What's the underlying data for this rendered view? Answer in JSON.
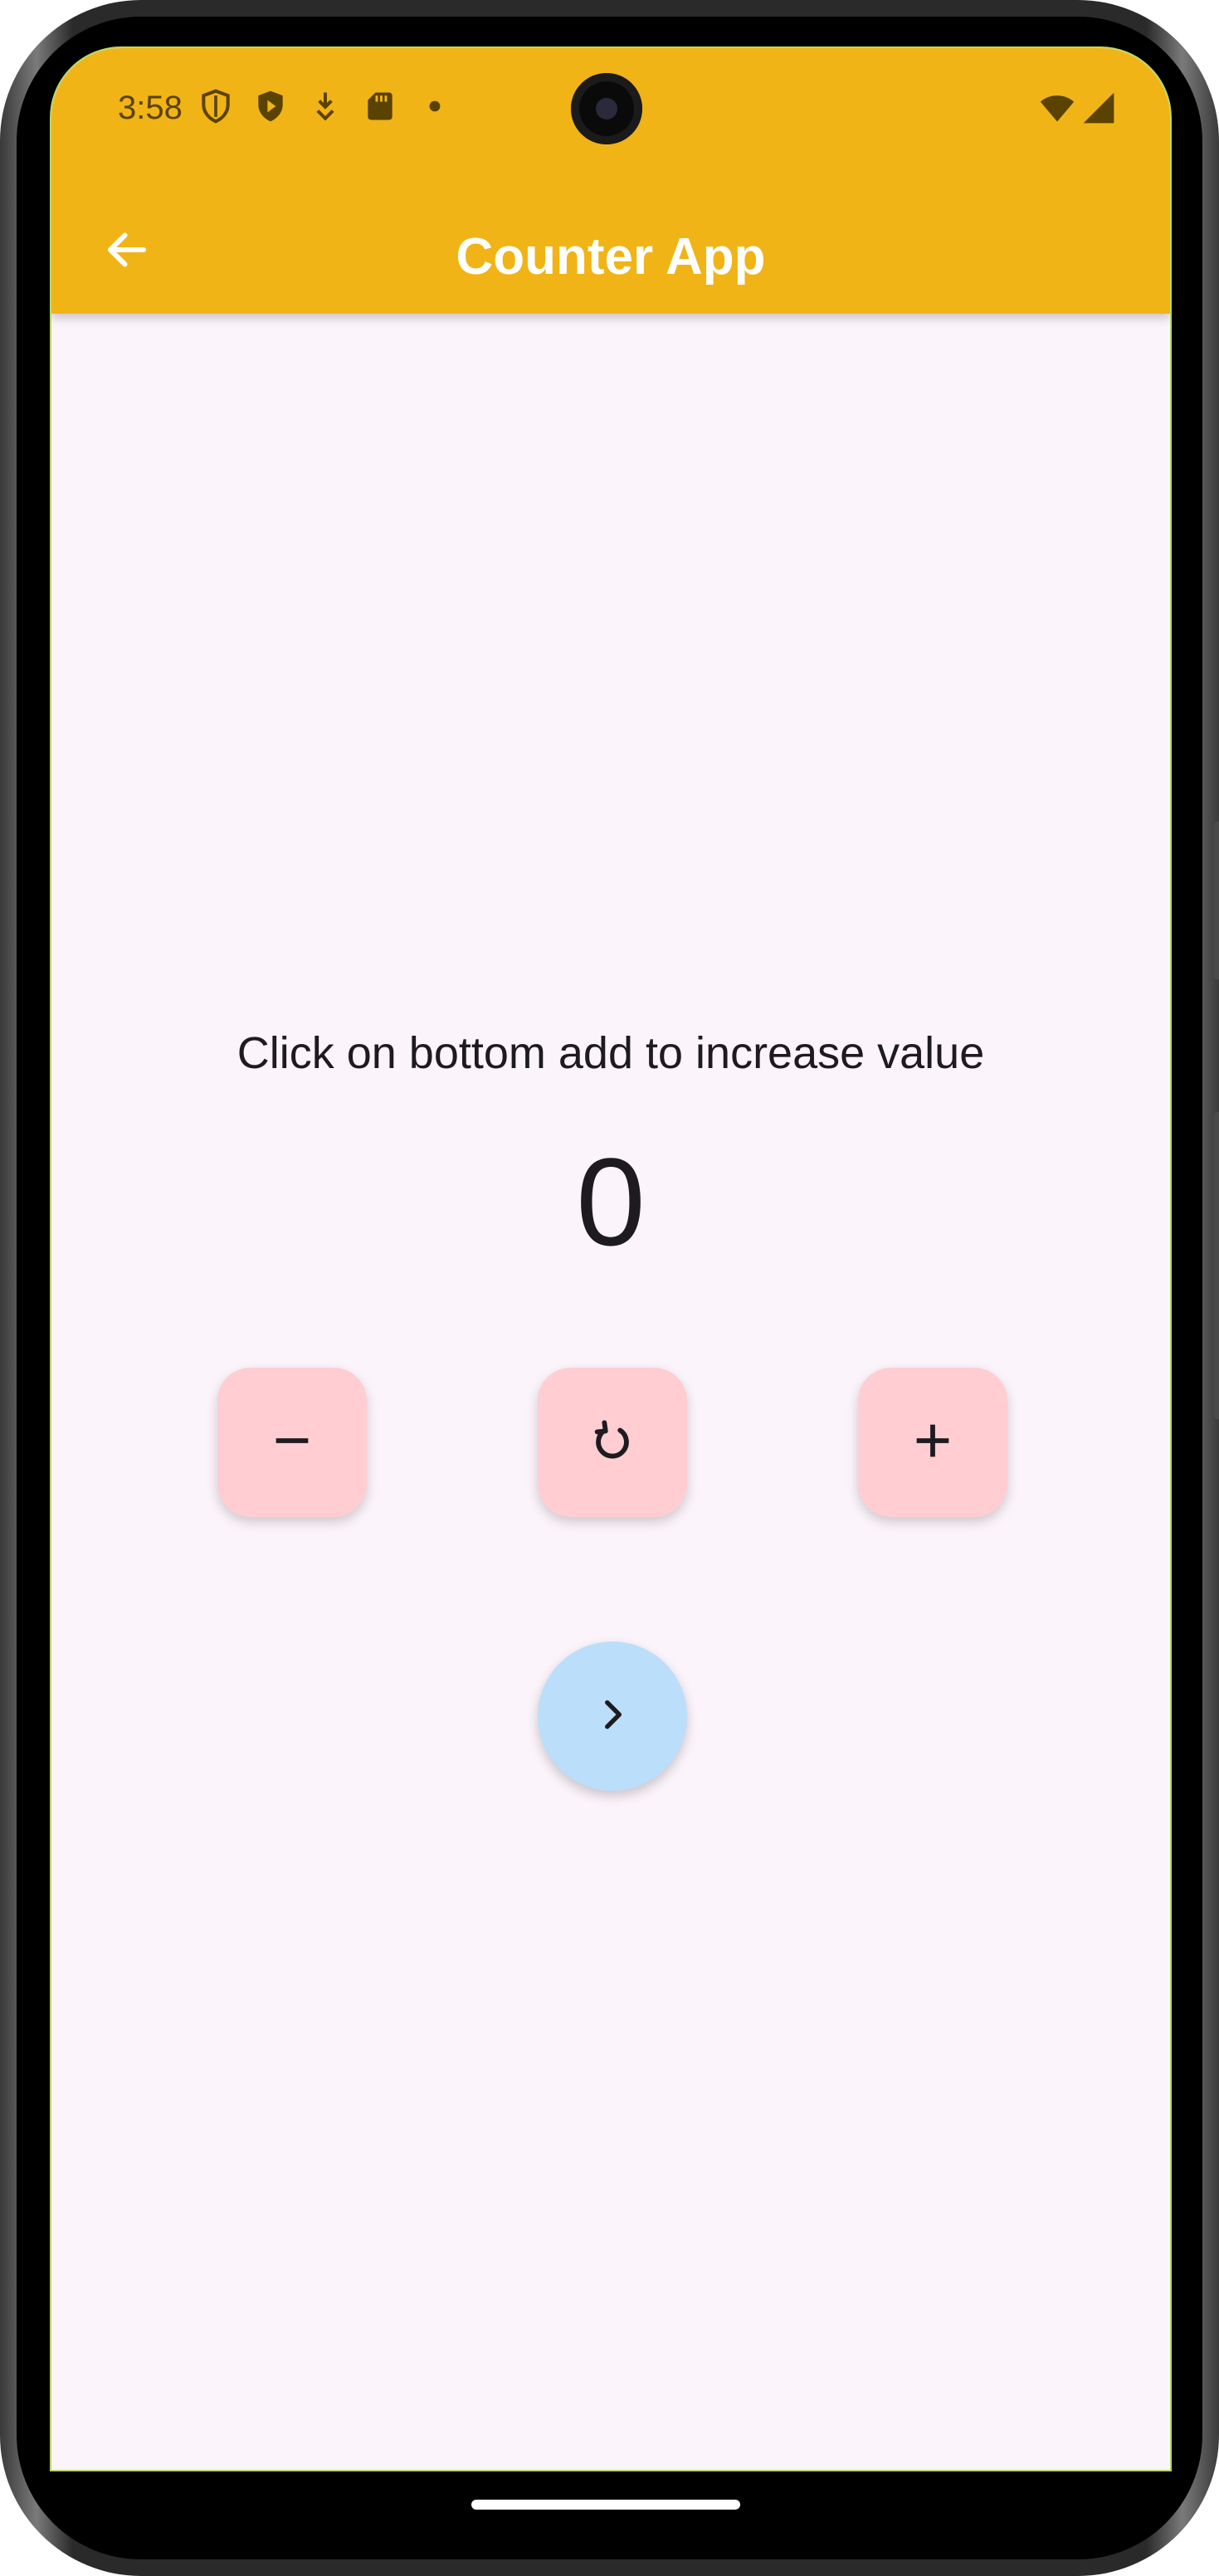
{
  "status_bar": {
    "time": "3:58",
    "left_icons": [
      "shield-icon",
      "play-protect-icon",
      "download-icon",
      "sd-card-icon",
      "dot-icon"
    ],
    "right_icons": [
      "wifi-icon",
      "signal-icon"
    ]
  },
  "app_bar": {
    "title": "Counter App",
    "back_icon": "arrow-back-icon",
    "color": "#f1b416"
  },
  "main": {
    "instruction": "Click on bottom add to increase value",
    "counter_value": "0"
  },
  "buttons": {
    "decrement_icon": "minus-icon",
    "reset_icon": "refresh-icon",
    "increment_icon": "plus-icon",
    "next_icon": "chevron-right-icon",
    "square_color": "#ffcdd2",
    "circle_color": "#bbdefb"
  },
  "colors": {
    "background": "#fbf4fa",
    "text": "#1d1b20"
  }
}
